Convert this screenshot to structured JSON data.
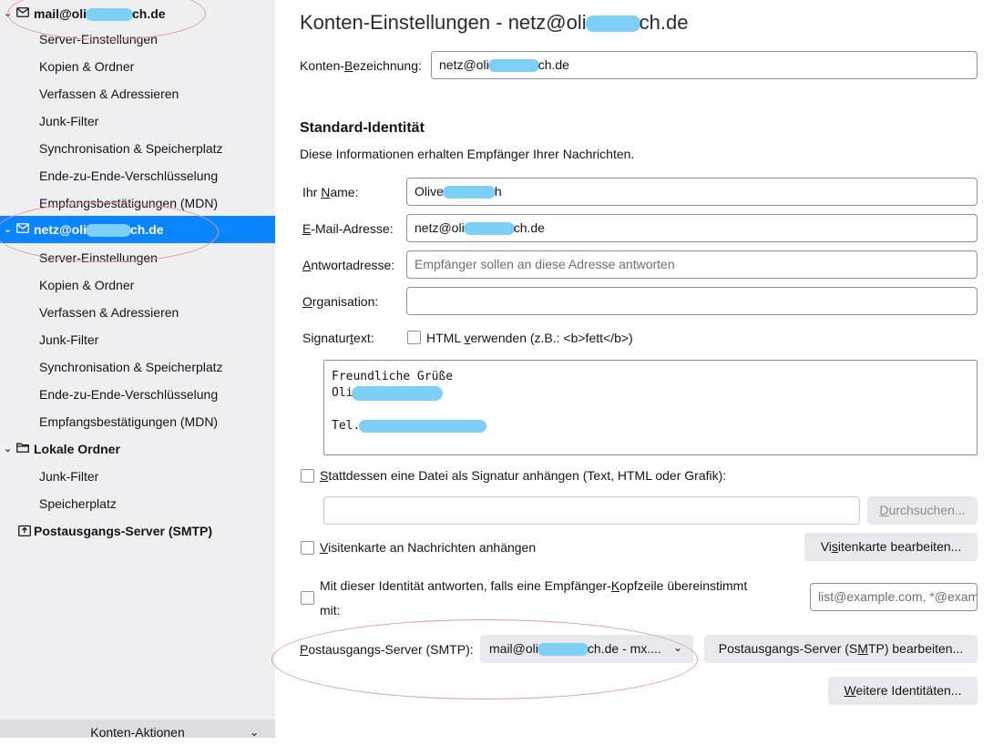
{
  "sidebar": {
    "account1": {
      "name_start": "mail@oli",
      "name_end": "ch.de"
    },
    "account1_items": [
      "Server-Einstellungen",
      "Kopien & Ordner",
      "Verfassen & Adressieren",
      "Junk-Filter",
      "Synchronisation & Speicherplatz",
      "Ende-zu-Ende-Verschlüsselung",
      "Empfangsbestätigungen (MDN)"
    ],
    "account2": {
      "name_start": "netz@oli",
      "name_end": "ch.de"
    },
    "account2_items": [
      "Server-Einstellungen",
      "Kopien & Ordner",
      "Verfassen & Adressieren",
      "Junk-Filter",
      "Synchronisation & Speicherplatz",
      "Ende-zu-Ende-Verschlüsselung",
      "Empfangsbestätigungen (MDN)"
    ],
    "local_folders": {
      "label": "Lokale Ordner",
      "items": [
        "Junk-Filter",
        "Speicherplatz"
      ]
    },
    "smtp": "Postausgangs-Server (SMTP)",
    "actions": "Konten-Aktionen"
  },
  "page": {
    "title_start": "Konten-Einstellungen - netz@oli",
    "title_end": "ch.de"
  },
  "account_name": {
    "label_pre": "Konten-",
    "label_key": "B",
    "label_post": "ezeichnung:",
    "value_start": "netz@oli",
    "value_end": "ch.de"
  },
  "identity": {
    "heading": "Standard-Identität",
    "description": "Diese Informationen erhalten Empfänger Ihrer Nachrichten.",
    "name": {
      "label_pre": "Ihr ",
      "label_key": "N",
      "label_post": "ame:",
      "value_start": "Olive",
      "value_end": "h"
    },
    "email": {
      "label_key": "E",
      "label_post": "-Mail-Adresse:",
      "value_start": "netz@oli",
      "value_end": "ch.de"
    },
    "reply": {
      "label_key": "A",
      "label_post": "ntwortadresse:",
      "placeholder": "Empfänger sollen an diese Adresse antworten"
    },
    "org": {
      "label_key": "O",
      "label_post": "rganisation:"
    },
    "signature": {
      "label_pre": "Signatur",
      "label_key": "t",
      "label_post": "ext:",
      "html_pre": "HTML ",
      "html_key": "v",
      "html_post": "erwenden (z.B.: <b>fett</b>)",
      "html_checked": false
    },
    "signature_text": {
      "line1": "Freundliche Grüße",
      "line2": "Oli",
      "line3": "Tel."
    },
    "attach_sig": {
      "label_key": "S",
      "label_post": "tattdessen eine Datei als Signatur anhängen (Text, HTML oder Grafik):",
      "browse_key": "D",
      "browse_post": "urchsuchen..."
    },
    "vcard": {
      "label_key": "V",
      "label_post": "isitenkarte an Nachrichten anhängen",
      "button_pre": "Vi",
      "button_key": "s",
      "button_post": "itenkarte bearbeiten..."
    },
    "reply_match": {
      "line1_pre": "Mit dieser Identität antworten, falls eine Empfänger-",
      "line1_key": "K",
      "line1_post": "opfzeile übereinstimmt",
      "line2": "mit:",
      "placeholder": "list@example.com, *@example.com"
    },
    "smtp": {
      "label_key": "P",
      "label_post": "ostausgangs-Server (SMTP):",
      "value_start": "mail@oli",
      "value_end": "ch.de - mx....",
      "edit_pre": "Postausgangs-Server (S",
      "edit_key": "M",
      "edit_post": "TP) bearbeiten..."
    },
    "more": {
      "key": "W",
      "post": "eitere Identitäten..."
    }
  }
}
